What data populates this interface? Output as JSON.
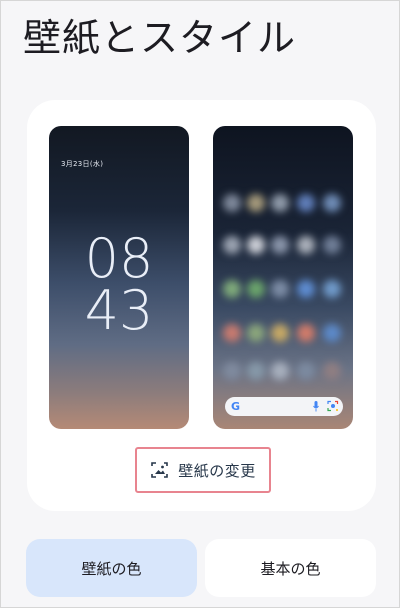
{
  "page": {
    "title": "壁紙とスタイル"
  },
  "lock_screen": {
    "date": "3月23日(水)",
    "hour": "08",
    "minute": "43"
  },
  "home_screen": {
    "search_logo": "G",
    "icons": [
      "google-logo-icon",
      "mic-icon",
      "lens-icon"
    ]
  },
  "change_wallpaper": {
    "label": "壁紙の変更",
    "icon": "image-edit-icon"
  },
  "color_tabs": {
    "wallpaper_color": "壁紙の色",
    "basic_color": "基本の色"
  },
  "colors": {
    "background": "#f6f6f8",
    "selected_tab": "#d8e6fb",
    "highlight_border": "#e8848f"
  }
}
